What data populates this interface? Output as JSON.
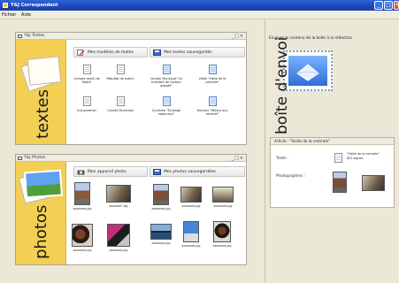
{
  "window": {
    "title": "Y&J Correspondent"
  },
  "menubar": {
    "items": [
      "Fichier",
      "Aide"
    ]
  },
  "texts_panel": {
    "header": "Y&J Textes",
    "side_word": "textes",
    "left_section": {
      "title": "Mes modèles de textes",
      "items": [
        "Compte-rendu de Match",
        "Résultat de match",
        "Inauguration",
        "Conseil Municipal"
      ]
    },
    "right_section": {
      "title": "Mes textes sauvegardés",
      "items": [
        "Conseil Municipal \"Le transfert de l'acteur adopté\"",
        "Visite \"Visite de la centrale\"",
        "Cyclisme \"Echange nationaux\"",
        "Humour \"Retour aux sources\""
      ]
    }
  },
  "photos_panel": {
    "header": "Y&J Photos",
    "side_word": "photos",
    "left_section": {
      "title": "Mon appareil photo",
      "items": [
        "aaaaaaaa.jpg",
        "aaaaaaa7.jpg",
        "aaaaaaaa.jpg",
        "aaaaaaaa.jpg"
      ]
    },
    "right_section": {
      "title": "Mes photos sauvegardées",
      "items": [
        "aaaaaaaa.jpg",
        "aaaaaaaa.jpg",
        "aaaaaaaa.jpg",
        "aaaaaaaa.jpg",
        "aaaaaaaa.jpg",
        "aaaaaaaa.jpg"
      ]
    }
  },
  "outbox": {
    "instruction": "Envoyer le contenu de la boîte à la rédaction",
    "word": "boîte d'envoi"
  },
  "article": {
    "header": "Article : \"Visite de la centrale\"",
    "text_label": "Texte :",
    "text_value": "\"Visite de la centrale\"",
    "text_size": "822 signes",
    "photos_label": "Photographies :"
  },
  "colors": {
    "title_blue": "#1e47b8",
    "accent_yellow": "#f3cf54",
    "panel_bg": "#ebe8d8"
  }
}
